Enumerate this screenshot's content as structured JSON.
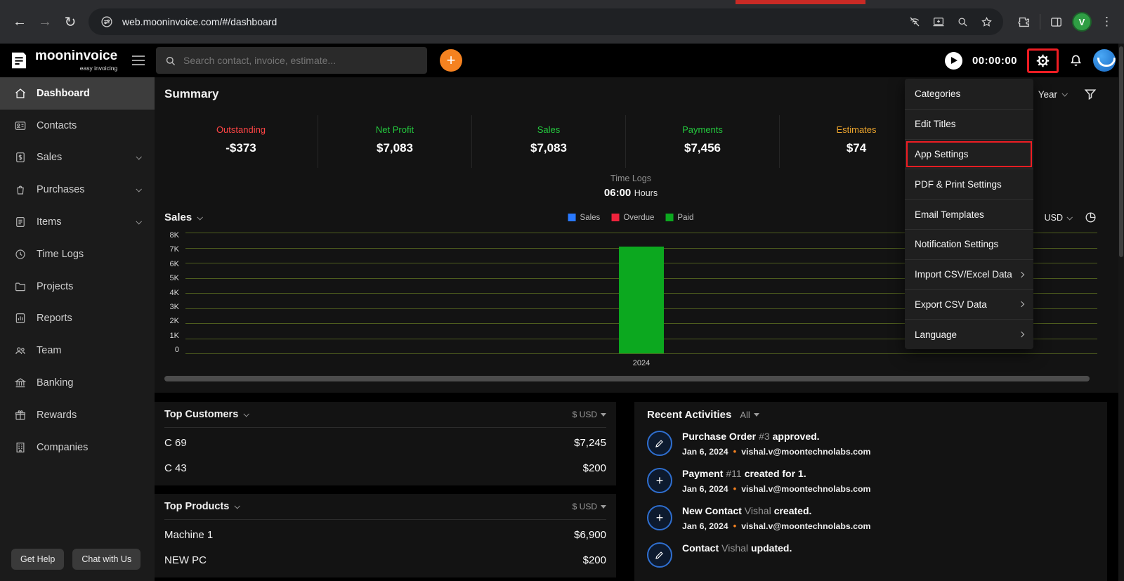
{
  "browser": {
    "url": "web.mooninvoice.com/#/dashboard"
  },
  "app_header": {
    "brand": "mooninvoice",
    "tagline": "easy invoicing",
    "search_placeholder": "Search contact, invoice, estimate...",
    "timer": "00:00:00",
    "browser_avatar_initial": "V"
  },
  "icons": {
    "search": "magnifier",
    "gear": "settings-gear",
    "bell": "notifications-bell",
    "play": "timer-play",
    "plus": "+",
    "filter": "funnel",
    "pie": "pie-chart",
    "edit": "pencil"
  },
  "sidebar": {
    "items": [
      {
        "label": "Dashboard"
      },
      {
        "label": "Contacts"
      },
      {
        "label": "Sales"
      },
      {
        "label": "Purchases"
      },
      {
        "label": "Items"
      },
      {
        "label": "Time Logs"
      },
      {
        "label": "Projects"
      },
      {
        "label": "Reports"
      },
      {
        "label": "Team"
      },
      {
        "label": "Banking"
      },
      {
        "label": "Rewards"
      },
      {
        "label": "Companies"
      }
    ],
    "get_help": "Get Help",
    "chat_with_us": "Chat with Us"
  },
  "summary": {
    "title": "Summary",
    "period": "Year",
    "cards": [
      {
        "label": "Outstanding",
        "value": "-$373",
        "color": "#ff4545"
      },
      {
        "label": "Net Profit",
        "value": "$7,083",
        "color": "#24c93e"
      },
      {
        "label": "Sales",
        "value": "$7,083",
        "color": "#24c93e"
      },
      {
        "label": "Payments",
        "value": "$7,456",
        "color": "#24c93e"
      },
      {
        "label": "Estimates",
        "value": "$74",
        "color": "#eda52d"
      }
    ],
    "time_logs_label": "Time Logs",
    "time_logs_value": "06:00",
    "time_logs_unit": "Hours"
  },
  "chart_data": {
    "type": "bar",
    "title": "Sales",
    "categories": [
      "2024"
    ],
    "series": [
      {
        "name": "Sales",
        "color": "#2979ff",
        "values": [
          0
        ]
      },
      {
        "name": "Overdue",
        "color": "#ef233c",
        "values": [
          0
        ]
      },
      {
        "name": "Paid",
        "color": "#0ca81f",
        "values": [
          7083
        ]
      }
    ],
    "ylim": [
      0,
      8000
    ],
    "yticks": [
      "8K",
      "7K",
      "6K",
      "5K",
      "4K",
      "3K",
      "2K",
      "1K",
      "0"
    ],
    "currency": "USD",
    "grid": true,
    "legend_position": "top-center"
  },
  "top_customers": {
    "title": "Top Customers",
    "currency": "$ USD",
    "rows": [
      {
        "name": "C 69",
        "value": "$7,245"
      },
      {
        "name": "C 43",
        "value": "$200"
      }
    ]
  },
  "top_products": {
    "title": "Top Products",
    "currency": "$ USD",
    "rows": [
      {
        "name": "Machine 1",
        "value": "$6,900"
      },
      {
        "name": "NEW PC",
        "value": "$200"
      }
    ]
  },
  "recent_activities": {
    "title": "Recent Activities",
    "filter": "All",
    "items": [
      {
        "main": "Purchase Order",
        "ref": "#3",
        "tail": "approved.",
        "date": "Jan 6, 2024",
        "email": "vishal.v@moontechnolabs.com"
      },
      {
        "main": "Payment",
        "ref": "#11",
        "tail": "created for 1.",
        "date": "Jan 6, 2024",
        "email": "vishal.v@moontechnolabs.com"
      },
      {
        "main": "New Contact",
        "ref": "Vishal",
        "tail": "created.",
        "date": "Jan 6, 2024",
        "email": "vishal.v@moontechnolabs.com"
      },
      {
        "main": "Contact",
        "ref": "Vishal",
        "tail": "updated."
      }
    ]
  },
  "settings_menu": {
    "items": [
      {
        "label": "Categories"
      },
      {
        "label": "Edit Titles"
      },
      {
        "label": "App Settings",
        "highlighted": true
      },
      {
        "label": "PDF & Print Settings"
      },
      {
        "label": "Email Templates"
      },
      {
        "label": "Notification Settings"
      },
      {
        "label": "Import CSV/Excel Data",
        "submenu": true
      },
      {
        "label": "Export CSV Data",
        "submenu": true
      },
      {
        "label": "Language",
        "submenu": true
      }
    ]
  }
}
